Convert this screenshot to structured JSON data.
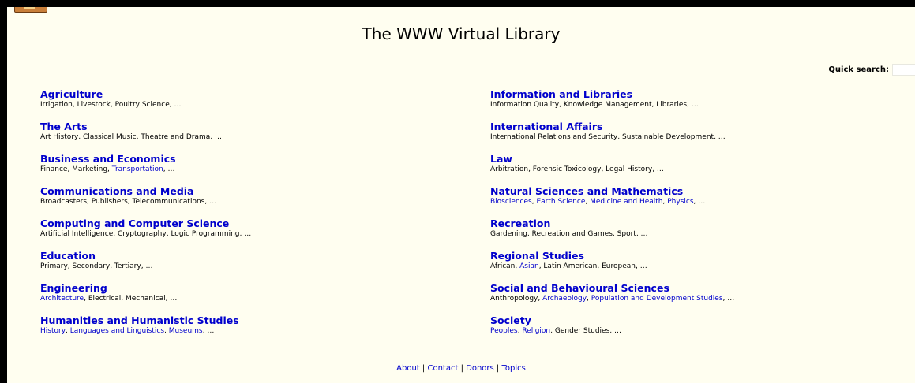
{
  "page": {
    "title": "The WWW Virtual Library"
  },
  "search": {
    "label": "Quick search:",
    "value": ""
  },
  "colors": {
    "background": "#fffef0",
    "frame": "#000000",
    "link": "#0000cc"
  },
  "left_categories": [
    {
      "title": "Agriculture",
      "subs": [
        {
          "text": "Irrigation",
          "link": false
        },
        {
          "text": "Livestock",
          "link": false
        },
        {
          "text": "Poultry Science",
          "link": false
        }
      ]
    },
    {
      "title": "The Arts",
      "subs": [
        {
          "text": "Art History",
          "link": false
        },
        {
          "text": "Classical Music",
          "link": false
        },
        {
          "text": "Theatre and Drama",
          "link": false
        }
      ]
    },
    {
      "title": "Business and Economics",
      "subs": [
        {
          "text": "Finance",
          "link": false
        },
        {
          "text": "Marketing",
          "link": false
        },
        {
          "text": "Transportation",
          "link": true
        }
      ]
    },
    {
      "title": "Communications and Media",
      "subs": [
        {
          "text": "Broadcasters",
          "link": false
        },
        {
          "text": "Publishers",
          "link": false
        },
        {
          "text": "Telecommunications",
          "link": false
        }
      ]
    },
    {
      "title": "Computing and Computer Science",
      "subs": [
        {
          "text": "Artificial Intelligence",
          "link": false
        },
        {
          "text": "Cryptography",
          "link": false
        },
        {
          "text": "Logic Programming",
          "link": false
        }
      ]
    },
    {
      "title": "Education",
      "subs": [
        {
          "text": "Primary",
          "link": false
        },
        {
          "text": "Secondary",
          "link": false
        },
        {
          "text": "Tertiary",
          "link": false
        }
      ]
    },
    {
      "title": "Engineering",
      "subs": [
        {
          "text": "Architecture",
          "link": true
        },
        {
          "text": "Electrical",
          "link": false
        },
        {
          "text": "Mechanical",
          "link": false
        }
      ]
    },
    {
      "title": "Humanities and Humanistic Studies",
      "subs": [
        {
          "text": "History",
          "link": true
        },
        {
          "text": "Languages and Linguistics",
          "link": true
        },
        {
          "text": "Museums",
          "link": true
        }
      ]
    }
  ],
  "right_categories": [
    {
      "title": "Information and Libraries",
      "subs": [
        {
          "text": "Information Quality",
          "link": false
        },
        {
          "text": "Knowledge Management",
          "link": false
        },
        {
          "text": "Libraries",
          "link": false
        }
      ]
    },
    {
      "title": "International Affairs",
      "subs": [
        {
          "text": "International Relations and Security",
          "link": false
        },
        {
          "text": "Sustainable Development",
          "link": false
        }
      ]
    },
    {
      "title": "Law",
      "subs": [
        {
          "text": "Arbitration",
          "link": false
        },
        {
          "text": "Forensic Toxicology",
          "link": false
        },
        {
          "text": "Legal History",
          "link": false
        }
      ]
    },
    {
      "title": "Natural Sciences and Mathematics",
      "subs": [
        {
          "text": "Biosciences",
          "link": true
        },
        {
          "text": "Earth Science",
          "link": true
        },
        {
          "text": "Medicine and Health",
          "link": true
        },
        {
          "text": "Physics",
          "link": true
        }
      ]
    },
    {
      "title": "Recreation",
      "subs": [
        {
          "text": "Gardening",
          "link": false
        },
        {
          "text": "Recreation and Games",
          "link": false
        },
        {
          "text": "Sport",
          "link": false
        }
      ]
    },
    {
      "title": "Regional Studies",
      "subs": [
        {
          "text": "African",
          "link": false
        },
        {
          "text": "Asian",
          "link": true
        },
        {
          "text": "Latin American",
          "link": false
        },
        {
          "text": "European",
          "link": false
        }
      ]
    },
    {
      "title": "Social and Behavioural Sciences",
      "subs": [
        {
          "text": "Anthropology",
          "link": false
        },
        {
          "text": "Archaeology",
          "link": true
        },
        {
          "text": "Population and Development Studies",
          "link": true
        }
      ]
    },
    {
      "title": "Society",
      "subs": [
        {
          "text": "Peoples",
          "link": true
        },
        {
          "text": "Religion",
          "link": true
        },
        {
          "text": "Gender Studies",
          "link": false
        }
      ]
    }
  ],
  "sub_separator": ", ",
  "sub_ellipsis": "…",
  "footer": {
    "links": [
      "About",
      "Contact",
      "Donors",
      "Topics"
    ],
    "separator": "|"
  }
}
